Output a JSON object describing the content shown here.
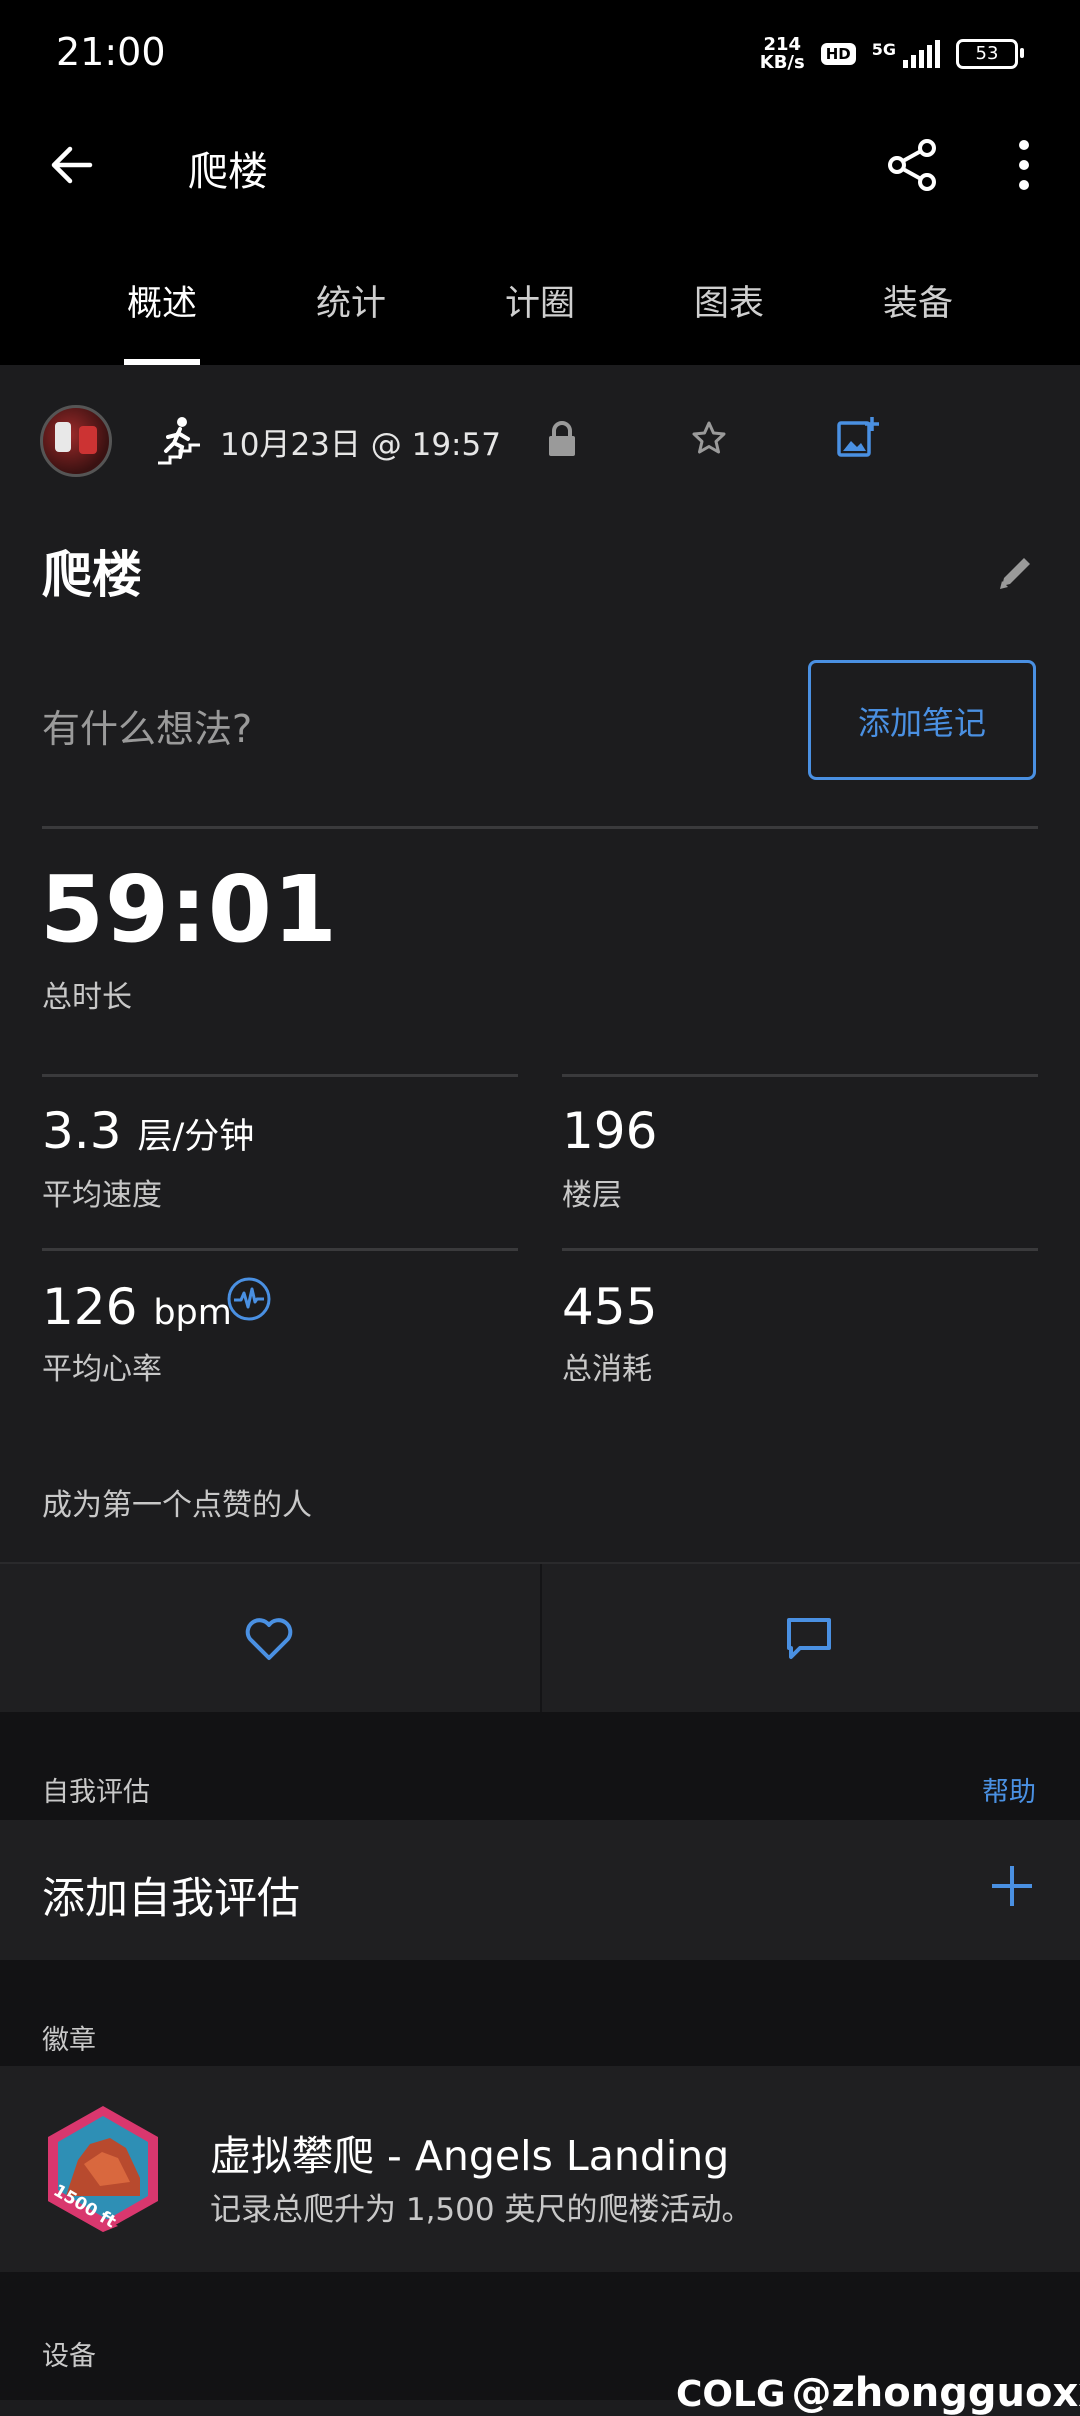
{
  "status_bar": {
    "time": "21:00",
    "net_speed_value": "214",
    "net_speed_unit": "KB/s",
    "hd": "HD",
    "network": "5G",
    "battery": "53"
  },
  "app_bar": {
    "title": "爬楼",
    "back_icon": "arrow-left-icon",
    "share_icon": "share-icon",
    "more_icon": "more-vertical-icon"
  },
  "tabs": [
    {
      "label": "概述",
      "active": true
    },
    {
      "label": "统计",
      "active": false
    },
    {
      "label": "计圈",
      "active": false
    },
    {
      "label": "图表",
      "active": false
    },
    {
      "label": "装备",
      "active": false
    }
  ],
  "activity_meta": {
    "date_time": "10月23日 @ 19:57",
    "activity_icon": "stair-climbing-icon"
  },
  "activity": {
    "title": "爬楼",
    "thoughts_placeholder": "有什么想法?",
    "add_note_label": "添加笔记"
  },
  "stats": {
    "duration_value": "59:01",
    "duration_label": "总时长",
    "avg_speed_value": "3.3",
    "avg_speed_unit": "层/分钟",
    "avg_speed_label": "平均速度",
    "floors_value": "196",
    "floors_label": "楼层",
    "avg_hr_value": "126",
    "avg_hr_unit": "bpm",
    "avg_hr_label": "平均心率",
    "calories_value": "455",
    "calories_label": "总消耗"
  },
  "social": {
    "likes_text": "成为第一个点赞的人"
  },
  "self_eval": {
    "section_header": "自我评估",
    "help_label": "帮助",
    "add_label": "添加自我评估"
  },
  "badges": {
    "section_header": "徽章",
    "badge_art_text": "1500 ft",
    "badge_title": "虚拟攀爬 - Angels Landing",
    "badge_desc": "记录总爬升为 1,500 英尺的爬楼活动。"
  },
  "devices": {
    "section_header": "设备"
  },
  "watermark": {
    "logo": "COLG",
    "handle": "@zhongguoxxc"
  },
  "colors": {
    "accent": "#4a90e2",
    "background": "#1c1c1e",
    "bar": "#000000"
  }
}
